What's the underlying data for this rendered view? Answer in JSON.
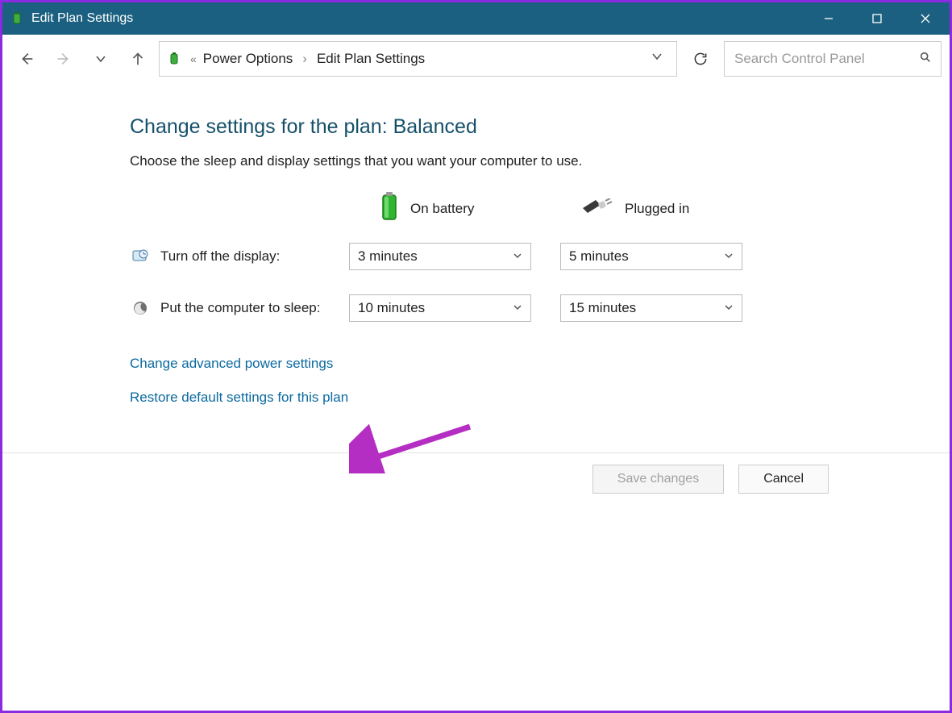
{
  "window": {
    "title": "Edit Plan Settings"
  },
  "breadcrumb": {
    "parent": "Power Options",
    "current": "Edit Plan Settings"
  },
  "search": {
    "placeholder": "Search Control Panel"
  },
  "page": {
    "heading": "Change settings for the plan: Balanced",
    "subtext": "Choose the sleep and display settings that you want your computer to use."
  },
  "columns": {
    "battery": "On battery",
    "plugged": "Plugged in"
  },
  "rows": {
    "display": {
      "label": "Turn off the display:",
      "battery": "3 minutes",
      "plugged": "5 minutes"
    },
    "sleep": {
      "label": "Put the computer to sleep:",
      "battery": "10 minutes",
      "plugged": "15 minutes"
    }
  },
  "links": {
    "advanced": "Change advanced power settings",
    "restore": "Restore default settings for this plan"
  },
  "buttons": {
    "save": "Save changes",
    "cancel": "Cancel"
  }
}
